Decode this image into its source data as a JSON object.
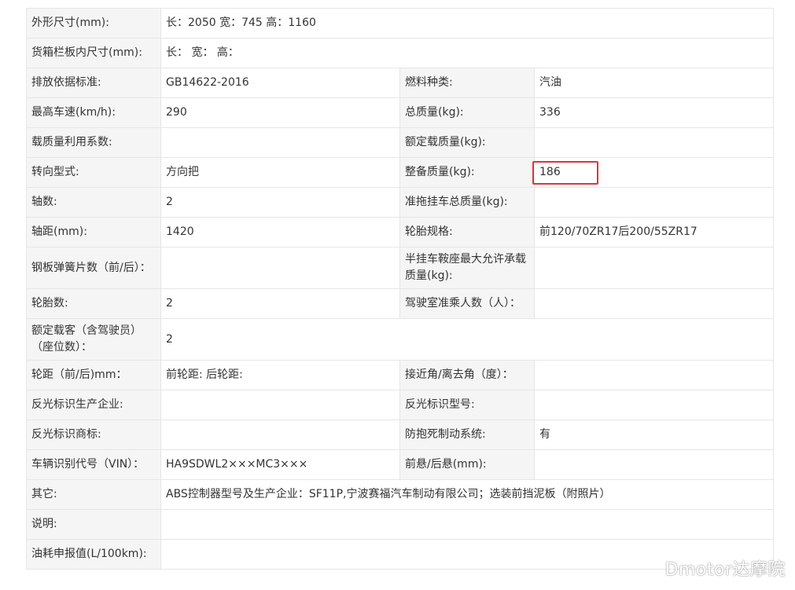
{
  "rows": [
    {
      "label_a": "外形尺寸(mm):",
      "value_a": "长：2050 宽：745 高：1160"
    },
    {
      "label_a": "货箱栏板内尺寸(mm):",
      "value_a": "长：  宽：  高："
    },
    {
      "label_a": "排放依据标准:",
      "value_a": "GB14622-2016",
      "label_b": "燃料种类:",
      "value_b": "汽油"
    },
    {
      "label_a": "最高车速(km/h):",
      "value_a": "290",
      "label_b": "总质量(kg):",
      "value_b": "336"
    },
    {
      "label_a": "载质量利用系数:",
      "value_a": "",
      "label_b": "额定载质量(kg):",
      "value_b": ""
    },
    {
      "label_a": "转向型式:",
      "value_a": "方向把",
      "label_b": "整备质量(kg):",
      "value_b": "186"
    },
    {
      "label_a": "轴数:",
      "value_a": "2",
      "label_b": "准拖挂车总质量(kg):",
      "value_b": ""
    },
    {
      "label_a": "轴距(mm):",
      "value_a": "1420",
      "label_b": "轮胎规格:",
      "value_b": "前120/70ZR17后200/55ZR17"
    },
    {
      "label_a": "钢板弹簧片数（前/后）：",
      "value_a": "",
      "label_b": "半挂车鞍座最大允许承载质量(kg):",
      "value_b": ""
    },
    {
      "label_a": "轮胎数:",
      "value_a": "2",
      "label_b": "驾驶室准乘人数（人）：",
      "value_b": ""
    },
    {
      "label_a": "额定载客（含驾驶员）（座位数）：",
      "value_a": "2"
    },
    {
      "label_a": "轮距（前/后)mm：",
      "value_a": "前轮距: 后轮距:",
      "label_b": "接近角/离去角（度）：",
      "value_b": ""
    },
    {
      "label_a": "反光标识生产企业:",
      "value_a": "",
      "label_b": "反光标识型号:",
      "value_b": ""
    },
    {
      "label_a": "反光标识商标:",
      "value_a": "",
      "label_b": "防抱死制动系统:",
      "value_b": "有"
    },
    {
      "label_a": "车辆识别代号（VIN）：",
      "value_a": "HA9SDWL2×××MC3×××",
      "label_b": "前悬/后悬(mm):",
      "value_b": ""
    },
    {
      "label_a": "其它:",
      "value_a": "ABS控制器型号及生产企业：SF11P,宁波赛福汽车制动有限公司；选装前挡泥板（附照片）"
    },
    {
      "label_a": "说明:",
      "value_a": ""
    },
    {
      "label_a": "油耗申报值(L/100km):",
      "value_a": ""
    }
  ],
  "highlight_color": "#d9363e",
  "watermark": "Dmotor达摩院"
}
